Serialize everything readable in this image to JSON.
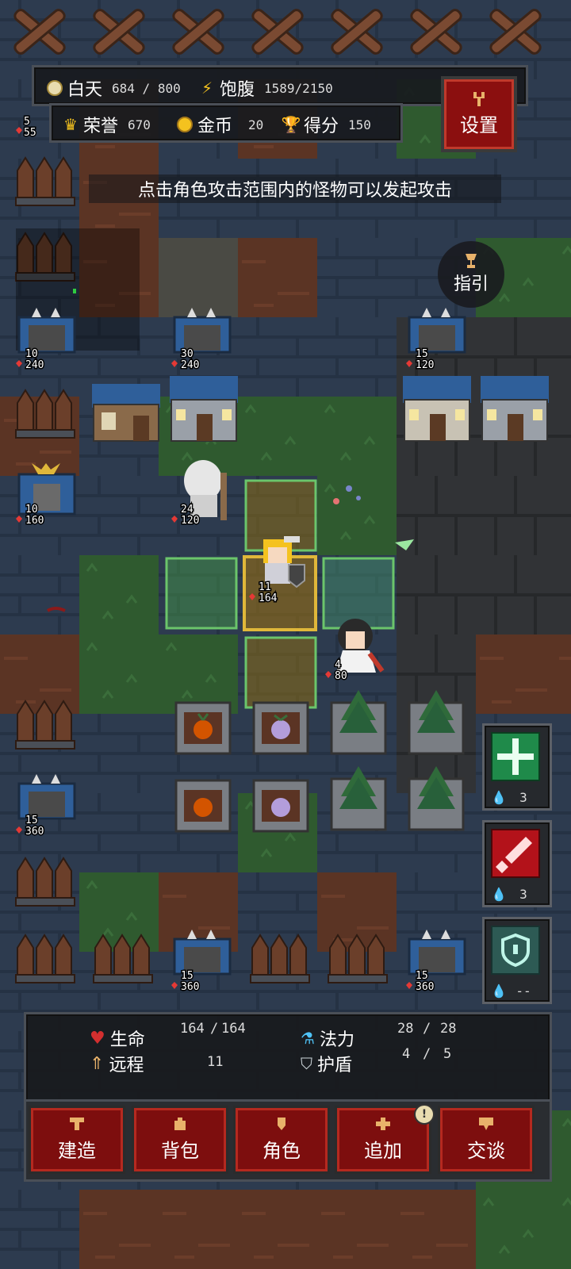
{
  "hud": {
    "daytime_label": "白天",
    "daytime_value": "684 / 800",
    "hunger_label": "饱腹",
    "hunger_value": "1589/2150",
    "honor_label": "荣誉",
    "honor_value": "670",
    "gold_label": "金币",
    "gold_value": "20",
    "score_label": "得分",
    "score_value": "150"
  },
  "settings_label": "设置",
  "guide_label": "指引",
  "hint_text": "点击角色攻击范围内的怪物可以发起攻击",
  "player": {
    "range": "11",
    "hp": "164",
    "hp_max": "164",
    "mp": "28",
    "mp_max": "28",
    "shield": "4",
    "shield_max": "5"
  },
  "stats_labels": {
    "hp": "生命",
    "range": "远程",
    "mp": "法力",
    "shield": "护盾"
  },
  "actions": {
    "build": "建造",
    "bag": "背包",
    "role": "角色",
    "add": "追加",
    "talk": "交谈"
  },
  "skills": [
    {
      "name": "holy-cross-skill",
      "cost": "3"
    },
    {
      "name": "slash-skill",
      "cost": "3"
    },
    {
      "name": "shield-skill",
      "cost": "--"
    }
  ],
  "units": [
    {
      "name": "enemy-fortress-topleft",
      "range": "5",
      "hp": "55"
    },
    {
      "name": "enemy-crossbow-1",
      "range": "10",
      "hp": "240"
    },
    {
      "name": "enemy-crossbow-2",
      "range": "30",
      "hp": "240"
    },
    {
      "name": "enemy-crossbow-3",
      "range": "15",
      "hp": "120"
    },
    {
      "name": "enemy-horned-tower",
      "range": "10",
      "hp": "160"
    },
    {
      "name": "elder-npc",
      "range": "24",
      "hp": "120"
    },
    {
      "name": "girl-npc",
      "range": "4",
      "hp": "80"
    },
    {
      "name": "enemy-crossbow-4",
      "range": "15",
      "hp": "360"
    },
    {
      "name": "enemy-crossbow-5",
      "range": "15",
      "hp": "360"
    },
    {
      "name": "enemy-crossbow-6",
      "range": "15",
      "hp": "360"
    }
  ],
  "colors": {
    "accent_red": "#8b0f0f",
    "panel_dark": "#181a1e",
    "highlight_yellow": "#e0b73a",
    "highlight_green": "#6bc56b"
  }
}
